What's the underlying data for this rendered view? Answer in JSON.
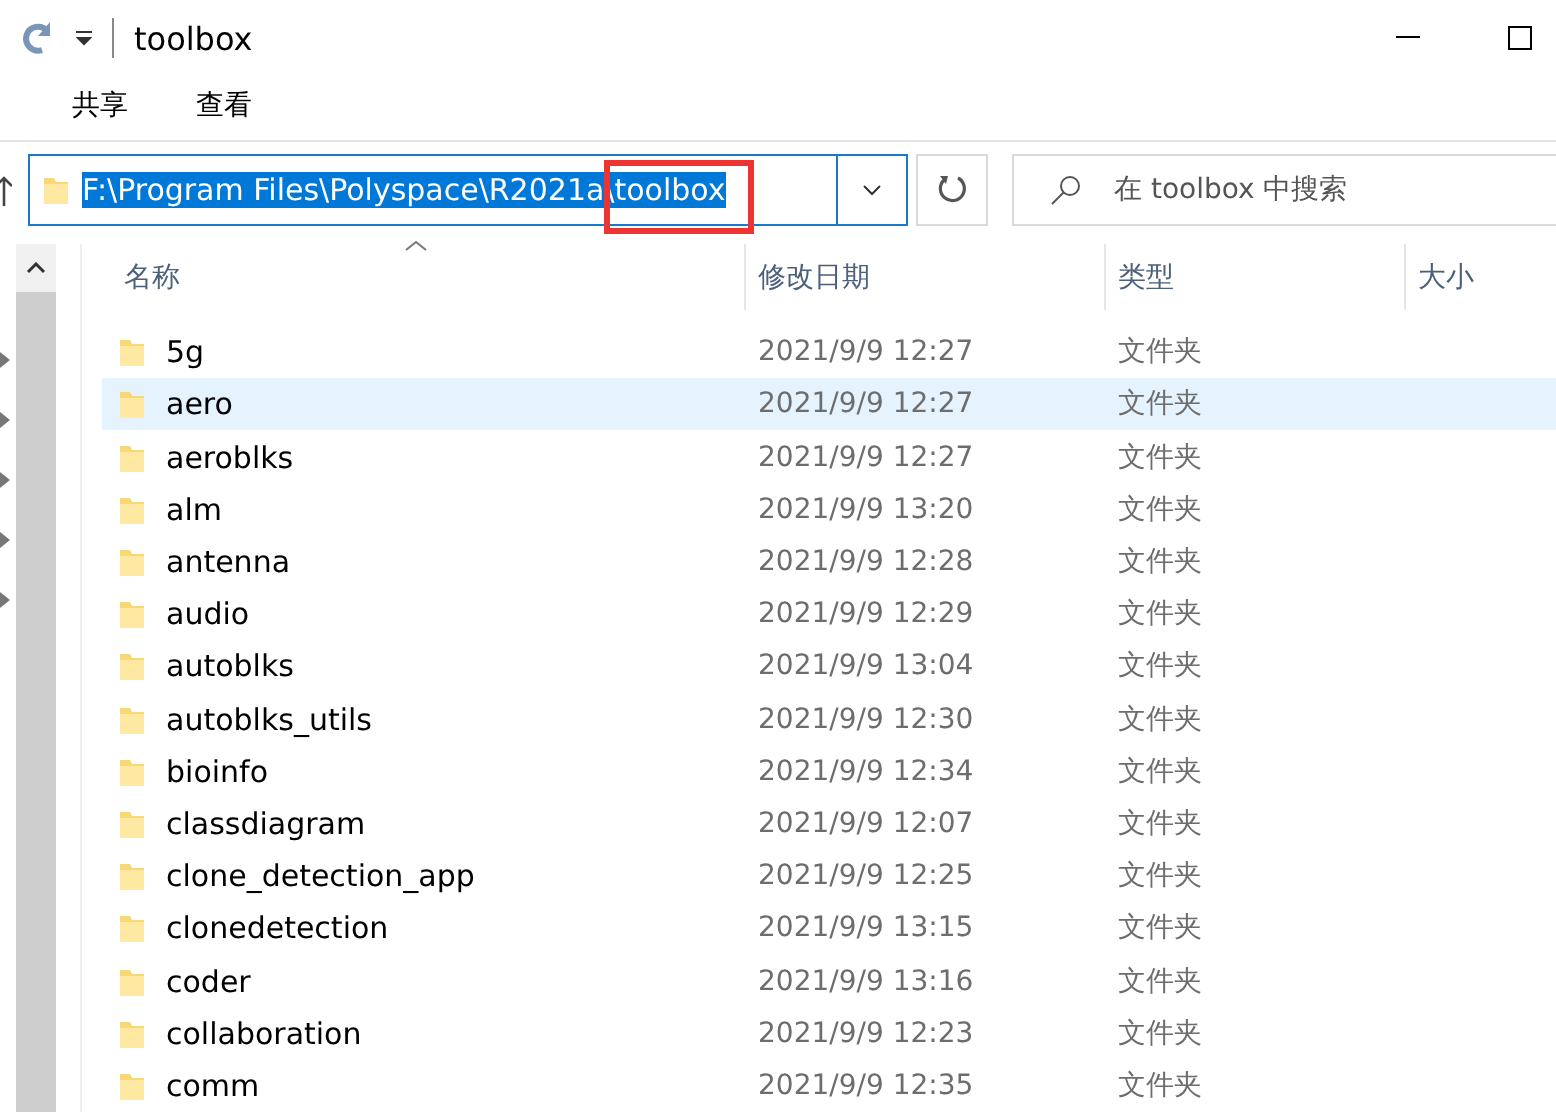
{
  "window": {
    "title": "toolbox"
  },
  "ribbon_tabs": [
    {
      "label": "共享",
      "selected": false
    },
    {
      "label": "查看",
      "selected": false
    }
  ],
  "address": {
    "path": "F:\\Program Files\\Polyspace\\R2021a\\toolbox",
    "highlighted": true
  },
  "search": {
    "placeholder": "在 toolbox 中搜索"
  },
  "columns": [
    "名称",
    "修改日期",
    "类型",
    "大小"
  ],
  "rows": [
    {
      "name": "5g",
      "date": "2021/9/9 12:27",
      "type": "文件夹",
      "selected": false
    },
    {
      "name": "aero",
      "date": "2021/9/9 12:27",
      "type": "文件夹",
      "selected": true
    },
    {
      "name": "aeroblks",
      "date": "2021/9/9 12:27",
      "type": "文件夹",
      "selected": false
    },
    {
      "name": "alm",
      "date": "2021/9/9 13:20",
      "type": "文件夹",
      "selected": false
    },
    {
      "name": "antenna",
      "date": "2021/9/9 12:28",
      "type": "文件夹",
      "selected": false
    },
    {
      "name": "audio",
      "date": "2021/9/9 12:29",
      "type": "文件夹",
      "selected": false
    },
    {
      "name": "autoblks",
      "date": "2021/9/9 13:04",
      "type": "文件夹",
      "selected": false
    },
    {
      "name": "autoblks_utils",
      "date": "2021/9/9 12:30",
      "type": "文件夹",
      "selected": false
    },
    {
      "name": "bioinfo",
      "date": "2021/9/9 12:34",
      "type": "文件夹",
      "selected": false
    },
    {
      "name": "classdiagram",
      "date": "2021/9/9 12:07",
      "type": "文件夹",
      "selected": false
    },
    {
      "name": "clone_detection_app",
      "date": "2021/9/9 12:25",
      "type": "文件夹",
      "selected": false
    },
    {
      "name": "clonedetection",
      "date": "2021/9/9 13:15",
      "type": "文件夹",
      "selected": false
    },
    {
      "name": "coder",
      "date": "2021/9/9 13:16",
      "type": "文件夹",
      "selected": false
    },
    {
      "name": "collaboration",
      "date": "2021/9/9 12:23",
      "type": "文件夹",
      "selected": false
    },
    {
      "name": "comm",
      "date": "2021/9/9 12:35",
      "type": "文件夹",
      "selected": false
    }
  ]
}
